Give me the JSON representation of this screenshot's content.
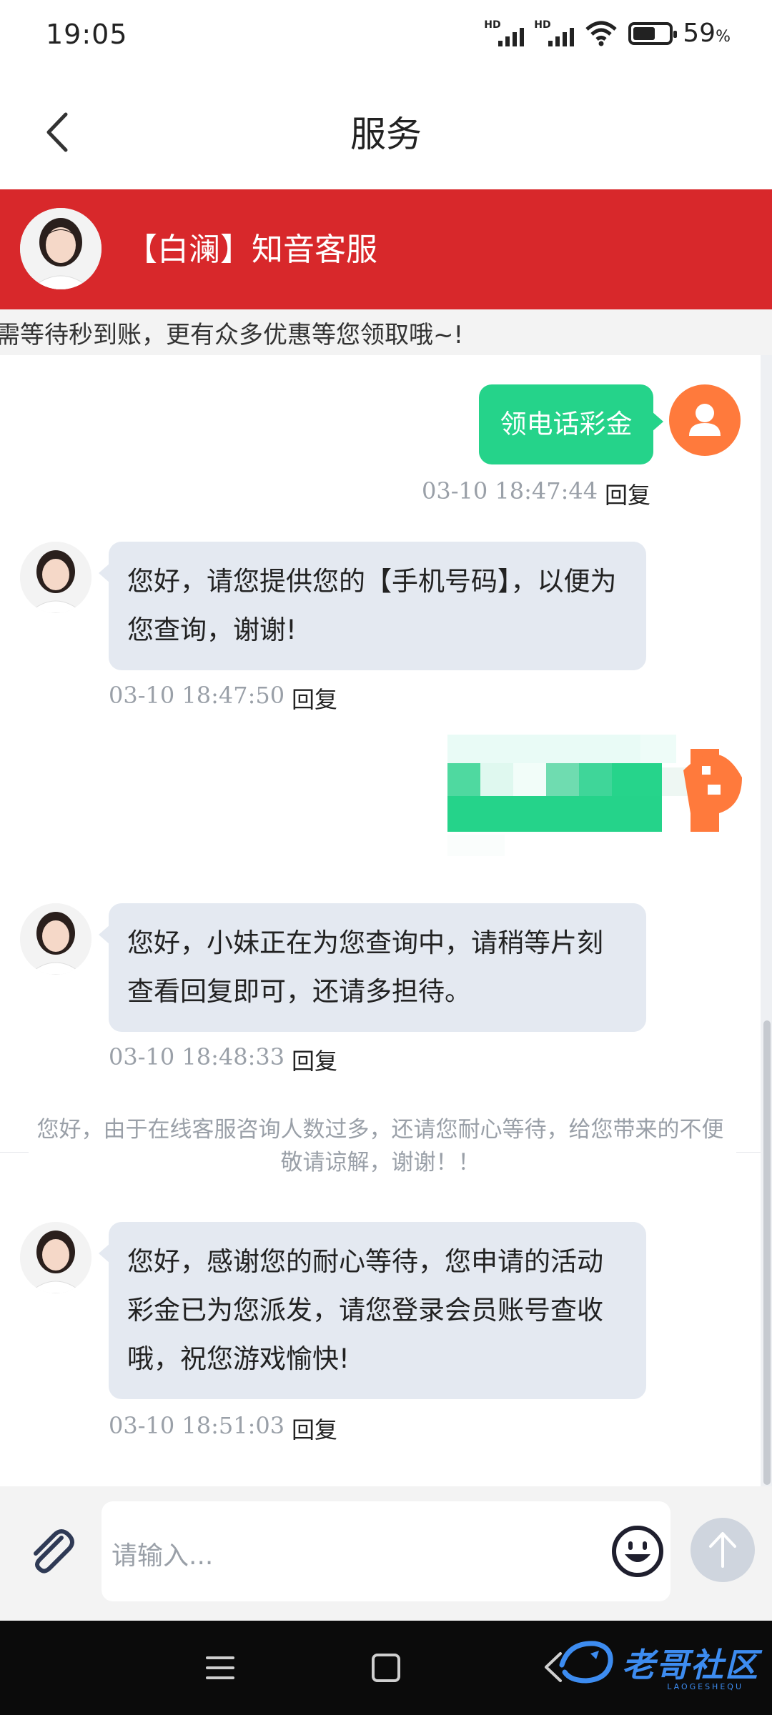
{
  "status_bar": {
    "time": "19:05",
    "signal_label_1": "HD",
    "signal_label_2": "HD",
    "battery_percent": "59",
    "battery_unit": "%"
  },
  "header": {
    "title": "服务"
  },
  "agent_banner": {
    "name": "【白澜】知音客服"
  },
  "marquee": {
    "text": "需等待秒到账，更有众多优惠等您领取哦~!"
  },
  "messages": [
    {
      "sender": "user",
      "text": "领电话彩金",
      "time": "03-10 18:47:44",
      "reply_label": "回复"
    },
    {
      "sender": "agent",
      "text": "您好，请您提供您的【手机号码】，以便为您查询，谢谢!",
      "time": "03-10 18:47:50",
      "reply_label": "回复"
    },
    {
      "sender": "user",
      "text": "",
      "redacted": true
    },
    {
      "sender": "agent",
      "text": "您好，小妹正在为您查询中，请稍等片刻查看回复即可，还请多担待。",
      "time": "03-10 18:48:33",
      "reply_label": "回复"
    },
    {
      "sender": "agent",
      "text": "您好，感谢您的耐心等待，您申请的活动彩金已为您派发，请您登录会员账号查收哦，祝您游戏愉快!",
      "time": "03-10 18:51:03",
      "reply_label": "回复"
    }
  ],
  "system_note": "您好，由于在线客服咨询人数过多，还请您耐心等待，给您带来的不便敬请谅解，谢谢！！",
  "input_bar": {
    "placeholder": "请输入..."
  },
  "watermark": {
    "text": "老哥社区",
    "sub": "LAOGESHEQU"
  },
  "colors": {
    "banner": "#d8282b",
    "user_bubble": "#25d38a",
    "agent_bubble": "#e4e9f1",
    "user_avatar": "#ff7a3c"
  }
}
